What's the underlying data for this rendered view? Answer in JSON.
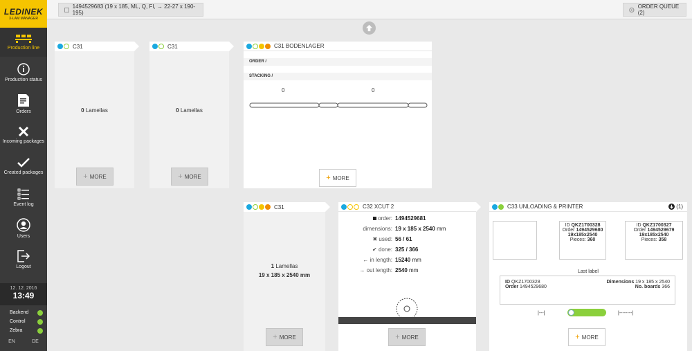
{
  "brand": {
    "name": "LEDINEK",
    "subtitle": "X-LAM MANAGER"
  },
  "sidebar": {
    "items": [
      {
        "label": "Production line"
      },
      {
        "label": "Production status"
      },
      {
        "label": "Orders"
      },
      {
        "label": "Incoming packages"
      },
      {
        "label": "Created packages"
      },
      {
        "label": "Event log"
      },
      {
        "label": "Users"
      },
      {
        "label": "Logout"
      }
    ],
    "date": "12. 12. 2016",
    "time": "13:49",
    "status": [
      {
        "label": "Backend",
        "color": "#8bd03c"
      },
      {
        "label": "Control",
        "color": "#8bd03c"
      },
      {
        "label": "Zebra",
        "color": "#8bd03c"
      }
    ],
    "langs": [
      "EN",
      "DE"
    ]
  },
  "topbar": {
    "package": "1494529683 (19 x 185, ML, Q, FI, → 22-27 x 190-195)",
    "queue": "ORDER QUEUE (2)"
  },
  "colors": {
    "cyan": "#1aa9e0",
    "green": "#8bd03c",
    "yellow": "#f5c400",
    "orange": "#f08c00"
  },
  "cards": {
    "c31a": {
      "title": "C31",
      "text": "Lamellas",
      "count": "0",
      "more": "MORE"
    },
    "c31b": {
      "title": "C31",
      "text": "Lamellas",
      "count": "0",
      "more": "MORE"
    },
    "bodenlager": {
      "title": "C31 BODENLAGER",
      "order_label": "ORDER /",
      "stacking_label": "STACKING /",
      "left_count": "0",
      "right_count": "0",
      "more": "MORE"
    },
    "c31c": {
      "title": "C31",
      "count": "1",
      "text": "Lamellas",
      "dims": "19 x 185 x 2540 mm",
      "more": "MORE"
    },
    "xcut": {
      "title": "C32 XCUT 2",
      "rows": [
        {
          "k": "order:",
          "v": "1494529681",
          "u": ""
        },
        {
          "k": "dimensions:",
          "v": "19 x 185 x 2540",
          "u": "mm"
        },
        {
          "k": "used:",
          "v": "56 / 61",
          "u": ""
        },
        {
          "k": "done:",
          "v": "325 / 366",
          "u": ""
        },
        {
          "k": "in length:",
          "v": "15240",
          "u": "mm"
        },
        {
          "k": "out length:",
          "v": "2540",
          "u": "mm"
        }
      ],
      "more": "MORE"
    },
    "unloading": {
      "title": "C33 UNLOADING & PRINTER",
      "badge": "(1)",
      "label1": {
        "id_label": "ID",
        "id": "QKZ1700328",
        "order_label": "Order",
        "order": "1494529680",
        "dims": "19x185x2540",
        "pieces_label": "Pieces:",
        "pieces": "360"
      },
      "label2": {
        "id_label": "ID",
        "id": "QKZ1700327",
        "order_label": "Order",
        "order": "1494529679",
        "dims": "19x185x2540",
        "pieces_label": "Pieces:",
        "pieces": "358"
      },
      "last_label": {
        "title": "Last label",
        "id_label": "ID",
        "id": "QKZ1700328",
        "order_label": "Order",
        "order": "1494529680",
        "dims_label": "Dimensions",
        "dims": "19 x 185 x 2540",
        "boards_label": "No. boards",
        "boards": "366"
      },
      "left_marker": "|---|",
      "right_marker": "|--------|",
      "more": "MORE"
    }
  }
}
